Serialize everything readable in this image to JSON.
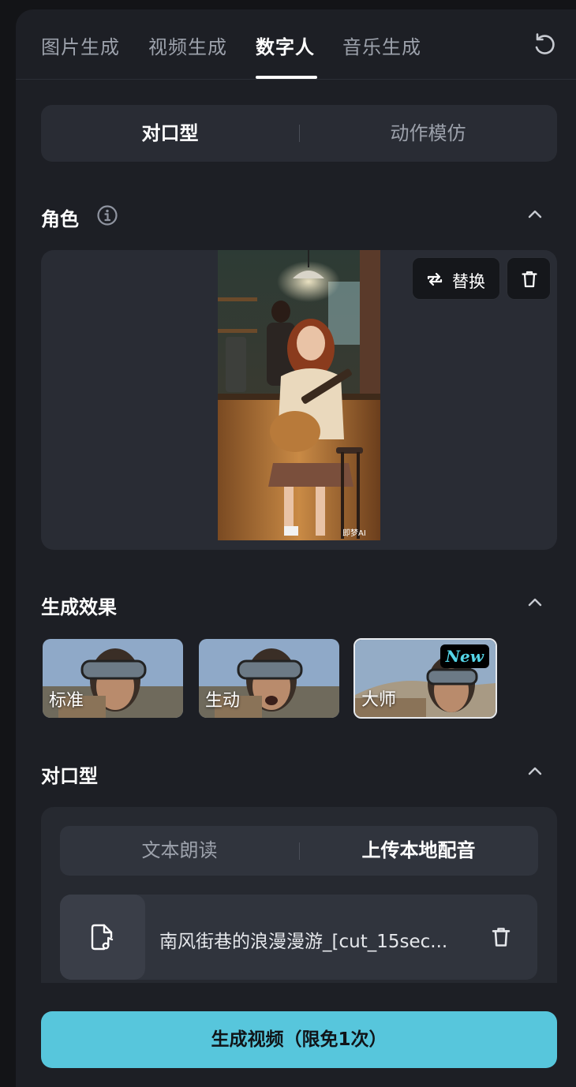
{
  "tabs": [
    {
      "label": "图片生成"
    },
    {
      "label": "视频生成"
    },
    {
      "label": "数字人",
      "active": true
    },
    {
      "label": "音乐生成"
    }
  ],
  "mode_segment": {
    "options": [
      "对口型",
      "动作模仿"
    ],
    "selected": "对口型"
  },
  "character": {
    "title": "角色",
    "replace_label": "替换",
    "photo_watermark": "即梦AI"
  },
  "effects": {
    "title": "生成效果",
    "items": [
      {
        "label": "标准"
      },
      {
        "label": "生动"
      },
      {
        "label": "大师",
        "badge": "New",
        "selected": true
      }
    ]
  },
  "lip_sync": {
    "title": "对口型",
    "options": [
      "文本朗读",
      "上传本地配音"
    ],
    "selected": "上传本地配音",
    "file_name": "南风街巷的浪漫漫游_[cut_15sec..."
  },
  "generate_button": "生成视频（限免1次）",
  "colors": {
    "accent": "#57c6dc",
    "panel_bg": "#1d1f25",
    "card_bg": "#292c34",
    "badge_text": "#55d6e8"
  }
}
